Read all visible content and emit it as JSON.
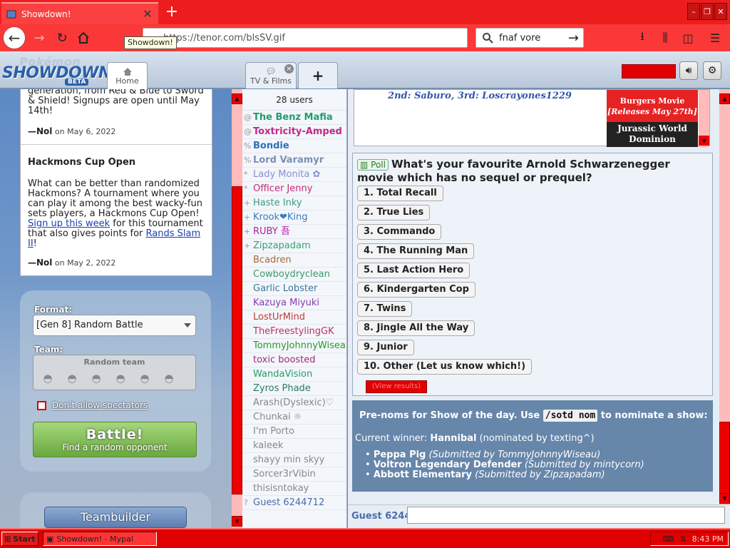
{
  "browser": {
    "tab_title": "Showdown!",
    "tooltip": "Showdown!",
    "url": "https://tenor.com/blsSV.gif",
    "search_value": "fnaf vore"
  },
  "showdown": {
    "logo_pokemon": "Pokémon",
    "logo_showdown": "SHOWDOWN!",
    "logo_beta": "BETA",
    "tabs": {
      "home": "Home",
      "tv": "TV & Films",
      "add": "+"
    }
  },
  "news": {
    "item1": {
      "text_tail": "generation, from Red & Blue to Sword & Shield! Signups are open until May 14th!",
      "author": "—Nol",
      "date": "on May 6, 2022"
    },
    "item2": {
      "title": "Hackmons Cup Open",
      "text_a": "What can be better than randomized Hackmons? A tournament where you can play it among the best wacky-fun sets players, a Hackmons Cup Open! ",
      "link1": "Sign up this week",
      "text_b": " for this tournament that also gives points for ",
      "link2": "Rands Slam II",
      "text_c": "!",
      "author": "—Nol",
      "date": "on May 2, 2022"
    }
  },
  "battle_form": {
    "format_label": "Format:",
    "format_value": "[Gen 8] Random Battle",
    "team_label": "Team:",
    "team_value": "Random team",
    "spectators_label": "Don't allow spectators",
    "battle_label": "Battle!",
    "battle_sub": "Find a random opponent",
    "teambuilder": "Teambuilder"
  },
  "userlist": {
    "count": "28 users",
    "users": [
      {
        "g": "@",
        "n": "The Benz Mafia",
        "c": "#1e9e6e",
        "b": true
      },
      {
        "g": "@",
        "n": "Toxtricity-Amped",
        "c": "#c0288a",
        "b": true
      },
      {
        "g": "%",
        "n": "Bondie",
        "c": "#2f6fb8",
        "b": true
      },
      {
        "g": "%",
        "n": "Lord Varamyr",
        "c": "#7a8fb8",
        "b": true
      },
      {
        "g": "*",
        "n": "Lady Monita ✿",
        "c": "#8a8fd0",
        "b": false
      },
      {
        "g": "*",
        "n": "Officer Jenny",
        "c": "#c8287a",
        "b": false
      },
      {
        "g": "+",
        "n": "Haste Inky",
        "c": "#3a9a8a",
        "b": false
      },
      {
        "g": "+",
        "n": "Krook❤King",
        "c": "#3a7ac0",
        "b": false
      },
      {
        "g": "+",
        "n": "RUBY 吾",
        "c": "#b020a0",
        "b": false
      },
      {
        "g": "+",
        "n": "Zipzapadam",
        "c": "#3aa070",
        "b": false
      },
      {
        "g": "",
        "n": "Bcadren",
        "c": "#a86a3a",
        "b": false
      },
      {
        "g": "",
        "n": "Cowboydryclean",
        "c": "#3a9a6a",
        "b": false
      },
      {
        "g": "",
        "n": "Garlic Lobster",
        "c": "#3a7a9a",
        "b": false
      },
      {
        "g": "",
        "n": "Kazuya Miyuki",
        "c": "#8a3ab0",
        "b": false
      },
      {
        "g": "",
        "n": "LostUrMind",
        "c": "#c03a3a",
        "b": false
      },
      {
        "g": "",
        "n": "TheFreestylingGK",
        "c": "#c0306a",
        "b": false
      },
      {
        "g": "",
        "n": "TommyJohnnyWiseau",
        "c": "#2a9a2a",
        "b": false
      },
      {
        "g": "",
        "n": "toxic boosted",
        "c": "#a02a7a",
        "b": false
      },
      {
        "g": "",
        "n": "WandaVision",
        "c": "#2a9a6a",
        "b": false
      },
      {
        "g": "",
        "n": "Zyros Phade",
        "c": "#2a7a6a",
        "b": false
      },
      {
        "g": "",
        "n": "Arash(Dyslexic)♡",
        "c": "#888888",
        "b": false
      },
      {
        "g": "",
        "n": "Chunkai ☼",
        "c": "#888888",
        "b": false
      },
      {
        "g": "",
        "n": "I'm Porto",
        "c": "#888888",
        "b": false
      },
      {
        "g": "",
        "n": "kaleek",
        "c": "#888888",
        "b": false
      },
      {
        "g": "",
        "n": "shayy min skyy",
        "c": "#888888",
        "b": false
      },
      {
        "g": "",
        "n": "Sorcer3rVibin",
        "c": "#888888",
        "b": false
      },
      {
        "g": "",
        "n": "thisisntokay",
        "c": "#888888",
        "b": false
      },
      {
        "g": "?",
        "n": "Guest 6244712",
        "c": "#4a6ea8",
        "b": false
      }
    ]
  },
  "chat": {
    "top_caption": "2nd: Saburo, 3rd: Loscrayones1229",
    "ad_line1": "Burgers Movie",
    "ad_line2": "[Releases May 27th]",
    "ad_line3": "Jurassic World",
    "ad_line4": "Dominion",
    "poll": {
      "tag": "Poll",
      "question": "What's your favourite Arnold Schwarzenegger movie which has no sequel or prequel?",
      "options": [
        "1. Total Recall",
        "2. True Lies",
        "3. Commando",
        "4. The Running Man",
        "5. Last Action Hero",
        "6. Kindergarten Cop",
        "7. Twins",
        "8. Jingle All the Way",
        "9. Junior",
        "10. Other (Let us know which!)"
      ],
      "view_results": "(View results)"
    },
    "sotd": {
      "heading_a": "Pre-noms for Show of the day. Use ",
      "command": "/sotd nom",
      "heading_b": " to nominate a show:",
      "winner_label": "Current winner: ",
      "winner_name": "Hannibal",
      "winner_tail": " (nominated by texting^)",
      "noms": [
        {
          "show": "Peppa Pig",
          "by": "(Submitted by TommyJohnnyWiseau)"
        },
        {
          "show": "Voltron Legendary Defender",
          "by": "(Submitted by mintycorn)"
        },
        {
          "show": "Abbott Elementary",
          "by": "(Submitted by Zipzapadam)"
        }
      ]
    },
    "input_name": "Guest 6244"
  },
  "taskbar": {
    "start": "Start",
    "task": "Showdown! - Mypal",
    "clock": "8:43 PM"
  }
}
